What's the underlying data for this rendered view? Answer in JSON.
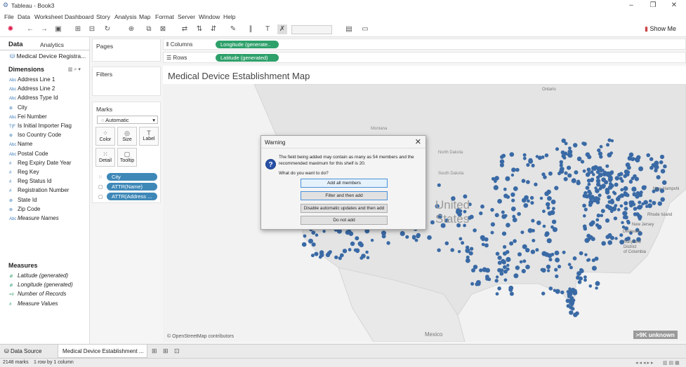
{
  "window": {
    "title": "Tableau - Book3",
    "min": "–",
    "restore": "❐",
    "close": "✕"
  },
  "menu": [
    "File",
    "Data",
    "Worksheet",
    "Dashboard",
    "Story",
    "Analysis",
    "Map",
    "Format",
    "Server",
    "Window",
    "Help"
  ],
  "toolbar": {
    "show_me": "Show Me"
  },
  "datapane": {
    "tab_data": "Data",
    "tab_analytics": "Analytics",
    "datasource": "Medical Device Registra...",
    "dimensions_header": "Dimensions",
    "dimensions": [
      {
        "icon": "Abc",
        "label": "Address Line 1"
      },
      {
        "icon": "Abc",
        "label": "Address Line 2"
      },
      {
        "icon": "Abc",
        "label": "Address Type Id"
      },
      {
        "icon": "⊕",
        "label": "City"
      },
      {
        "icon": "Abc",
        "label": "Fei Number"
      },
      {
        "icon": "T|F",
        "label": "Is Initial Importer Flag"
      },
      {
        "icon": "⊕",
        "label": "Iso Country Code"
      },
      {
        "icon": "Abc",
        "label": "Name"
      },
      {
        "icon": "Abc",
        "label": "Postal Code"
      },
      {
        "icon": "#",
        "label": "Reg Expiry Date Year"
      },
      {
        "icon": "#",
        "label": "Reg Key"
      },
      {
        "icon": "#",
        "label": "Reg Status Id"
      },
      {
        "icon": "#",
        "label": "Registration Number"
      },
      {
        "icon": "⊕",
        "label": "State Id"
      },
      {
        "icon": "⊕",
        "label": "Zip Code"
      },
      {
        "icon": "Abc",
        "label": "Measure Names"
      }
    ],
    "measures_header": "Measures",
    "measures": [
      {
        "icon": "⊕",
        "label": "Latitude (generated)"
      },
      {
        "icon": "⊕",
        "label": "Longitude (generated)"
      },
      {
        "icon": "=#",
        "label": "Number of Records"
      },
      {
        "icon": "#",
        "label": "Measure Values"
      }
    ]
  },
  "cards": {
    "pages": "Pages",
    "filters": "Filters",
    "marks": "Marks",
    "mark_type": "Automatic",
    "mark_buttons": [
      "Color",
      "Size",
      "Label",
      "Detail",
      "Tooltip"
    ],
    "mark_pills": [
      "City",
      "ATTR(Name)",
      "ATTR(Address ..."
    ]
  },
  "shelves": {
    "columns_label": "Columns",
    "columns_pill": "Longitude (generate..",
    "rows_label": "Rows",
    "rows_pill": "Latitude (generated)"
  },
  "view": {
    "title": "Medical Device Establishment Map",
    "attribution": "© OpenStreetMap contributors",
    "unknown_badge": ">9K unknown",
    "map_labels": {
      "country": "United",
      "country2": "States",
      "ontario": "Ontario",
      "mexico": "Mexico",
      "north_dakota": "North Dakota",
      "south_dakota": "South Dakota",
      "montana": "Montana",
      "new_hampshire": "New Hampshi",
      "rhode_island": "Rhode Island",
      "new_jersey": "New Jersey",
      "delaware": "Delaware",
      "maryland": "Maryland",
      "dc": "District",
      "dc2": "of Columbia"
    },
    "map_bg": "#e6e6e6",
    "dot_color": "#3a6aa5"
  },
  "dialog": {
    "title": "Warning",
    "message": "The field being added may contain as many as 54 members and the recommended maximum for this shelf is 20.",
    "question": "What do you want to do?",
    "buttons": [
      "Add all members",
      "Filter and then add",
      "Disable automatic updates and then add",
      "Do not add"
    ]
  },
  "tabs": {
    "datasource": "Data Source",
    "sheet": "Medical Device Establishment ..."
  },
  "status": {
    "marks": "2148 marks",
    "grid": "1 row by 1 column"
  }
}
